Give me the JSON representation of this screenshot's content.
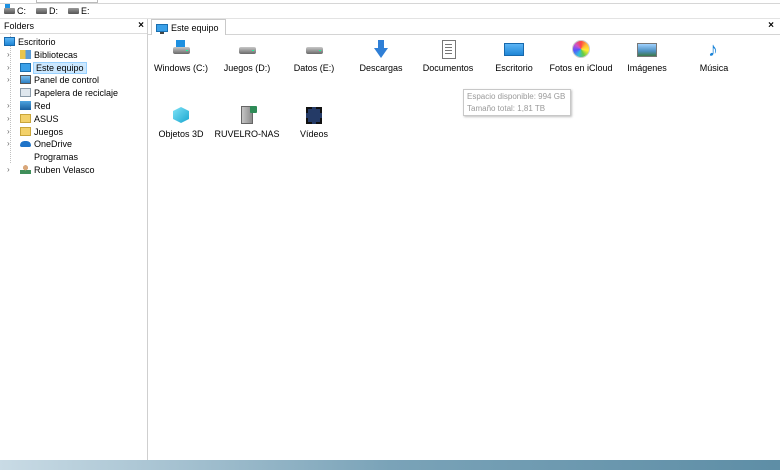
{
  "drives": [
    {
      "label": "C:",
      "icon": "system-drive-icon"
    },
    {
      "label": "D:",
      "icon": "drive-icon"
    },
    {
      "label": "E:",
      "icon": "drive-icon"
    }
  ],
  "sidebar": {
    "title": "Folders",
    "close": "×",
    "root": "Escritorio",
    "items": [
      {
        "label": "Bibliotecas",
        "expandable": true,
        "icon": "libraries-icon"
      },
      {
        "label": "Este equipo",
        "expandable": true,
        "selected": true,
        "icon": "computer-icon"
      },
      {
        "label": "Panel de control",
        "expandable": true,
        "icon": "control-panel-icon"
      },
      {
        "label": "Papelera de reciclaje",
        "expandable": false,
        "icon": "recycle-bin-icon"
      },
      {
        "label": "Red",
        "expandable": true,
        "icon": "network-icon"
      },
      {
        "label": "ASUS",
        "expandable": true,
        "icon": "folder-icon"
      },
      {
        "label": "Juegos",
        "expandable": true,
        "icon": "folder-icon"
      },
      {
        "label": "OneDrive",
        "expandable": true,
        "icon": "onedrive-icon"
      },
      {
        "label": "Programas",
        "expandable": false,
        "icon": "none"
      },
      {
        "label": "Ruben Velasco",
        "expandable": true,
        "icon": "user-icon"
      }
    ]
  },
  "tab": {
    "label": "Este equipo",
    "close": "×"
  },
  "items": [
    {
      "label": "Windows (C:)",
      "icon": "system-drive-icon"
    },
    {
      "label": "Juegos (D:)",
      "icon": "hard-drive-icon"
    },
    {
      "label": "Datos (E:)",
      "icon": "hard-drive-icon"
    },
    {
      "label": "Descargas",
      "icon": "downloads-icon"
    },
    {
      "label": "Documentos",
      "icon": "documents-icon"
    },
    {
      "label": "Escritorio",
      "icon": "desktop-icon"
    },
    {
      "label": "Fotos en iCloud",
      "icon": "icloud-photos-icon"
    },
    {
      "label": "Imágenes",
      "icon": "pictures-icon"
    },
    {
      "label": "Música",
      "icon": "music-icon"
    },
    {
      "label": "Objetos 3D",
      "icon": "3d-objects-icon"
    },
    {
      "label": "RUVELRO-NAS",
      "icon": "nas-icon"
    },
    {
      "label": "Vídeos",
      "icon": "videos-icon"
    }
  ],
  "tooltip": {
    "line1": "Espacio disponible: 994 GB",
    "line2": "Tamaño total: 1,81 TB"
  },
  "colors": {
    "selection": "#cce8ff",
    "accent": "#1e90e0"
  }
}
